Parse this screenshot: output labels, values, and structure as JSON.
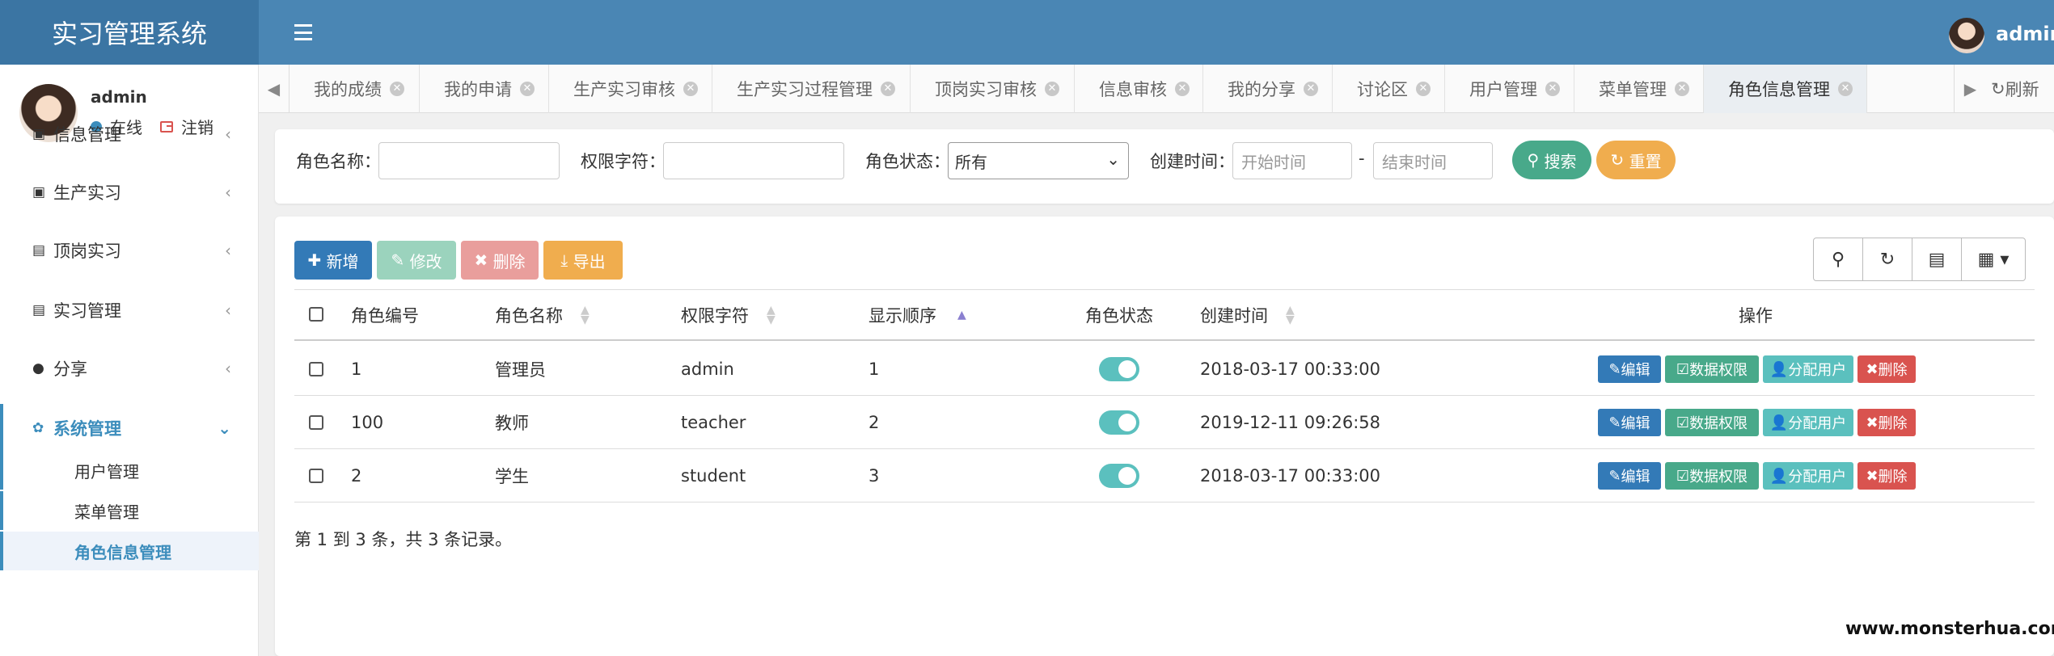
{
  "app": {
    "title": "实习管理系统",
    "user": "admin"
  },
  "sidebar": {
    "user": "admin",
    "status_online": "在线",
    "logout": "注销",
    "menu": [
      {
        "label": "信息管理",
        "icon": "id-card-icon"
      },
      {
        "label": "生产实习",
        "icon": "user-icon"
      },
      {
        "label": "顶岗实习",
        "icon": "id-badge-icon"
      },
      {
        "label": "实习管理",
        "icon": "address-card-icon"
      },
      {
        "label": "分享",
        "icon": "comment-icon"
      },
      {
        "label": "系统管理",
        "icon": "gear-icon",
        "expanded": true
      }
    ],
    "submenu": [
      {
        "label": "用户管理"
      },
      {
        "label": "菜单管理"
      },
      {
        "label": "角色信息管理",
        "active": true
      }
    ]
  },
  "tabs": {
    "items": [
      {
        "label": "我的成绩"
      },
      {
        "label": "我的申请"
      },
      {
        "label": "生产实习审核"
      },
      {
        "label": "生产实习过程管理"
      },
      {
        "label": "顶岗实习审核"
      },
      {
        "label": "信息审核"
      },
      {
        "label": "我的分享"
      },
      {
        "label": "讨论区"
      },
      {
        "label": "用户管理"
      },
      {
        "label": "菜单管理"
      },
      {
        "label": "角色信息管理",
        "active": true
      }
    ],
    "refresh": "刷新"
  },
  "search": {
    "role_name_label": "角色名称：",
    "role_key_label": "权限字符：",
    "status_label": "角色状态：",
    "status_value": "所有",
    "created_label": "创建时间：",
    "start_placeholder": "开始时间",
    "dash": "-",
    "end_placeholder": "结束时间",
    "search_btn": "搜索",
    "reset_btn": "重置"
  },
  "toolbar": {
    "add": "新增",
    "edit": "修改",
    "delete": "删除",
    "export": "导出"
  },
  "table": {
    "columns": [
      "角色编号",
      "角色名称",
      "权限字符",
      "显示顺序",
      "角色状态",
      "创建时间",
      "操作"
    ],
    "rows": [
      {
        "id": "1",
        "name": "管理员",
        "key": "admin",
        "order": "1",
        "enabled": true,
        "created": "2018-03-17 00:33:00"
      },
      {
        "id": "100",
        "name": "教师",
        "key": "teacher",
        "order": "2",
        "enabled": true,
        "created": "2019-12-11 09:26:58"
      },
      {
        "id": "2",
        "name": "学生",
        "key": "student",
        "order": "3",
        "enabled": true,
        "created": "2018-03-17 00:33:00"
      }
    ],
    "actions": {
      "edit": "编辑",
      "data_perm": "数据权限",
      "assign": "分配用户",
      "delete": "删除"
    }
  },
  "pagination_text": "第 1 到 3 条，共 3 条记录。",
  "watermark": "www.monsterhua.com",
  "colors": {
    "header": "#4a86b4",
    "logo_bg": "#3b75a3",
    "primary": "#337ab7",
    "success": "#5cb85c",
    "info": "#5bc0de",
    "danger": "#d9534f",
    "warning": "#f0ad4e",
    "teal": "#48a98a",
    "accent": "#3c8dbc"
  }
}
